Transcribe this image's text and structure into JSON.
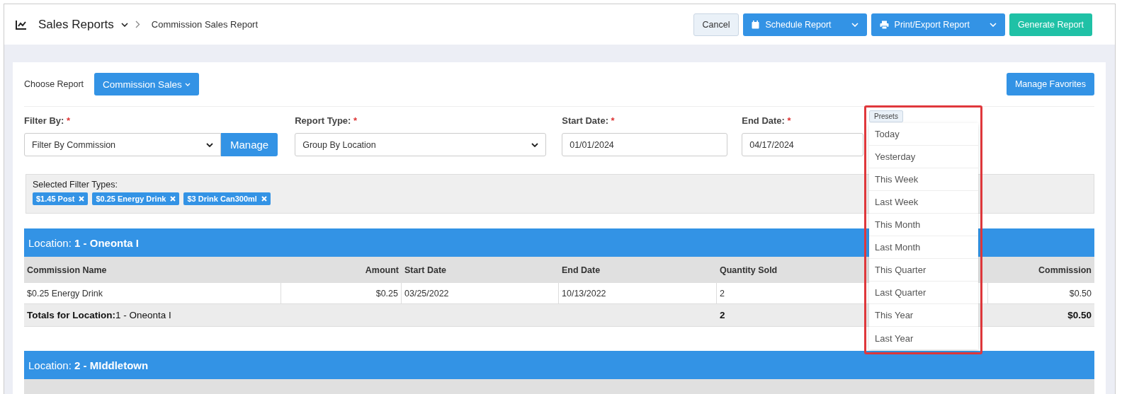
{
  "header": {
    "title": "Sales Reports",
    "breadcrumb": "Commission Sales Report",
    "buttons": [
      {
        "label": "Cancel",
        "kind": "cancel"
      },
      {
        "label": "Schedule Report",
        "kind": "schedule"
      },
      {
        "label": "Print/Export Report",
        "kind": "export"
      },
      {
        "label": "Generate Report",
        "kind": "generate"
      }
    ]
  },
  "report_picker": {
    "label": "Choose Report",
    "value": "Commission Sales",
    "favorites_button": "Manage Favorites"
  },
  "filters": [
    {
      "label": "Filter By:",
      "required_mark": "*",
      "kind": "select",
      "value": "Filter By Commission",
      "button": "Manage"
    },
    {
      "label": "Report Type:",
      "required_mark": "*",
      "kind": "select",
      "value": "Group By Location"
    },
    {
      "label": "Start Date:",
      "required_mark": "*",
      "kind": "date",
      "value": "01/01/2024"
    },
    {
      "label": "End Date:",
      "required_mark": "*",
      "kind": "date",
      "value": "04/17/2024"
    }
  ],
  "selected_filters": {
    "label": "Selected Filter Types:",
    "chips": [
      "$1.45 Post",
      "$0.25 Energy Drink",
      "$3 Drink Can300ml"
    ]
  },
  "presets": {
    "label": "Presets",
    "highlighted": true,
    "options": [
      "Today",
      "Yesterday",
      "This Week",
      "Last Week",
      "This Month",
      "Last Month",
      "This Quarter",
      "Last Quarter",
      "This Year",
      "Last Year"
    ]
  },
  "locations": [
    {
      "label": "Location:",
      "name": "1 - Oneonta I",
      "columns": [
        "Commission Name",
        "Amount",
        "Start Date",
        "End Date",
        "Quantity Sold",
        "Commission"
      ],
      "rows": [
        [
          "$0.25 Energy Drink",
          "$0.25",
          "03/25/2022",
          "10/13/2022",
          "2",
          "$0.50"
        ]
      ],
      "totals": {
        "label": "Totals for Location:",
        "name": "1 - Oneonta I",
        "quantity": "2",
        "commission": "$0.50"
      }
    },
    {
      "label": "Location:",
      "name": "2 - MIddletown"
    }
  ]
}
